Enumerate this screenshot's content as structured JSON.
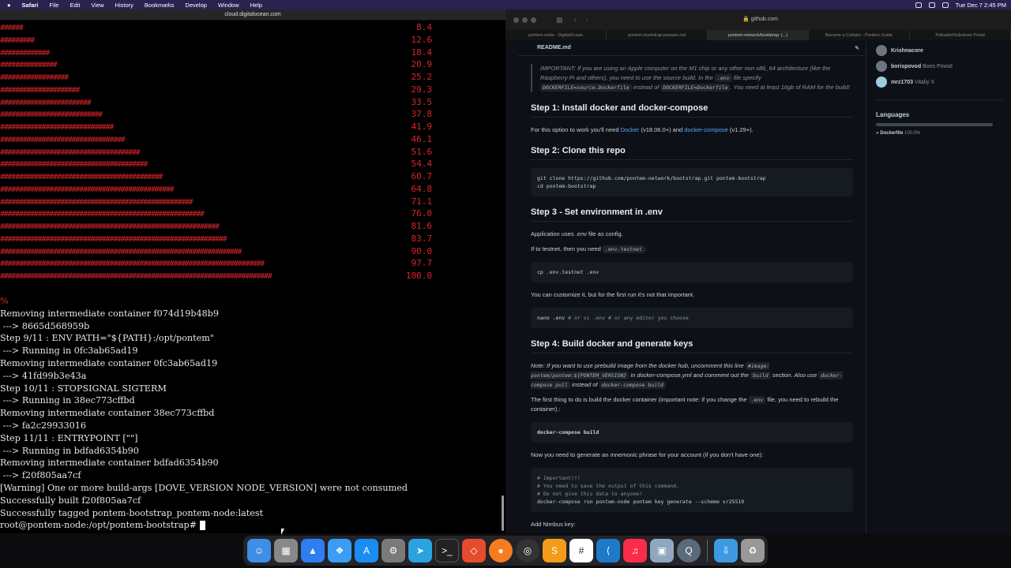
{
  "menubar": {
    "items": [
      "Safari",
      "File",
      "Edit",
      "View",
      "History",
      "Bookmarks",
      "Develop",
      "Window",
      "Help"
    ],
    "clock": "Tue Dec 7  2:45 PM"
  },
  "terminal": {
    "title": "cloud.digitalocean.com",
    "progress": [
      {
        "bar": "######",
        "pct": "8.4"
      },
      {
        "bar": "#########",
        "pct": "12.6"
      },
      {
        "bar": "#############",
        "pct": "18.4"
      },
      {
        "bar": "###############",
        "pct": "20.9"
      },
      {
        "bar": "##################",
        "pct": "25.2"
      },
      {
        "bar": "#####################",
        "pct": "29.3"
      },
      {
        "bar": "########################",
        "pct": "33.5"
      },
      {
        "bar": "###########################",
        "pct": "37.8"
      },
      {
        "bar": "##############################",
        "pct": "41.9"
      },
      {
        "bar": "#################################",
        "pct": "46.1"
      },
      {
        "bar": "#####################################",
        "pct": "51.6"
      },
      {
        "bar": "#######################################",
        "pct": "54.4"
      },
      {
        "bar": "###########################################",
        "pct": "60.7"
      },
      {
        "bar": "##############################################",
        "pct": "64.8"
      },
      {
        "bar": "###################################################",
        "pct": "71.1"
      },
      {
        "bar": "######################################################",
        "pct": "76.0"
      },
      {
        "bar": "##########################################################",
        "pct": "81.6"
      },
      {
        "bar": "############################################################",
        "pct": "83.7"
      },
      {
        "bar": "################################################################",
        "pct": "90.0"
      },
      {
        "bar": "######################################################################",
        "pct": "97.7"
      },
      {
        "bar": "########################################################################",
        "pct": "100.0"
      }
    ],
    "lines": [
      "Removing intermediate container f074d19b48b9",
      " ---> 8665d568959b",
      "Step 9/11 : ENV PATH=\"${PATH}:/opt/pontem\"",
      " ---> Running in 0fc3ab65ad19",
      "Removing intermediate container 0fc3ab65ad19",
      " ---> 41fd99b3e43a",
      "Step 10/11 : STOPSIGNAL SIGTERM",
      " ---> Running in 38ec773cffbd",
      "Removing intermediate container 38ec773cffbd",
      " ---> fa2c29933016",
      "Step 11/11 : ENTRYPOINT [\"\"]",
      " ---> Running in bdfad6354b90",
      "Removing intermediate container bdfad6354b90",
      " ---> f20f805aa7cf",
      "[Warning] One or more build-args [DOVE_VERSION NODE_VERSION] were not consumed",
      "Successfully built f20f805aa7cf",
      "Successfully tagged pontem-bootstrap_pontem-node:latest"
    ],
    "prompt": "root@pontem-node:/opt/pontem-bootstrap# "
  },
  "browser": {
    "url": "github.com",
    "tabs": [
      "pontem-node - DigitalOcean",
      "pontem-bootstrap-prepare.md",
      "pontem-network/bootstrap: (...)",
      "Become a Collator - Pontem Guide",
      "Polkadot/Substrate Portal"
    ],
    "readme_title": "README.md",
    "note": "IMPORTANT: If you are using an Apple computer on the M1 chip or any other non x86_64 architecture (like the Raspberry Pi and others), you need to use the source build. In the",
    "note_env": ".env",
    "note_b": "file specify",
    "note_code1": "DOCKERFILE=source.Dockerfile",
    "note_c": "instead of",
    "note_code2": "DOCKERFILE=Dockerfile",
    "note_d": ". You need at least 16gb of RAM for the build!",
    "h1": "Step 1: Install docker and docker-compose",
    "p1a": "For this option to work you'll need",
    "p1_link1": "Docker",
    "p1b": "(v18.06.0+) and",
    "p1_link2": "docker-compose",
    "p1c": "(v1.29+).",
    "h2": "Step 2: Clone this repo",
    "code2": "git clone https://github.com/pontem-network/bootstrap.git pontem-bootstrap\ncd pontem-bootstrap",
    "h3": "Step 3 - Set environment in .env",
    "p3a_1": "Application uses",
    "p3a_env": ".env",
    "p3a_2": "file as config.",
    "p3b": "If to testnet, then you need",
    "p3b_code": ".env.testnet",
    "code3": "cp .env.testnet .env",
    "p3c": "You can customize it, but for the first run it's not that important.",
    "code3b_cmd": "nano .env",
    "code3b_comment": "# or vi .env # or any editor you choose",
    "h4": "Step 4: Build docker and generate keys",
    "note4a": "Note: If you want to use prebuild image from the docker hub, uncomment this line",
    "note4_code1": "#image: pontem/pontem:${PONTEM_VERSION}",
    "note4b": "in docker-compose.yml and comment out the",
    "note4_code2": "build",
    "note4c": "section. Also use",
    "note4_code3": "docker-compose pull",
    "note4d": "instead of",
    "note4_code4": "docker-compose build",
    "p4a": "The first thing to do is build the docker container (important note: if you change the",
    "p4a_env": ".env",
    "p4a_b": "file, you need to rebuild the container).:",
    "code4": "docker-compose build",
    "p4b": "Now you need to generate an mnemonic phrase for your account (if you don't have one):",
    "code5_comment": "# Important!!!\n# You need to save the output of this command.\n# Do not give this data to anyone!",
    "code5_cmd": "docker-compose run pontem-node pontem key generate --scheme sr25519",
    "p5": "Add Nimbus key:",
    "contributors": [
      {
        "handle": "Krishnacore",
        "name": ""
      },
      {
        "handle": "borispovod",
        "name": "Boris Povod"
      },
      {
        "handle": "mrz1703",
        "name": "Vitaliy X"
      }
    ],
    "languages_title": "Languages",
    "language": "Dockerfile",
    "language_pct": "100.0%"
  },
  "dock": {
    "apps": [
      "finder-icon",
      "launchpad-icon",
      "instruments-icon",
      "safari-icon",
      "app-store-icon",
      "system-preferences-icon",
      "telegram-icon",
      "terminal-icon",
      "affinity-icon",
      "firefox-icon",
      "obs-icon",
      "sublime-icon",
      "slack-icon",
      "vscode-icon",
      "music-icon",
      "preview-icon",
      "quicktime-icon",
      "downloads-icon",
      "trash-icon"
    ]
  }
}
